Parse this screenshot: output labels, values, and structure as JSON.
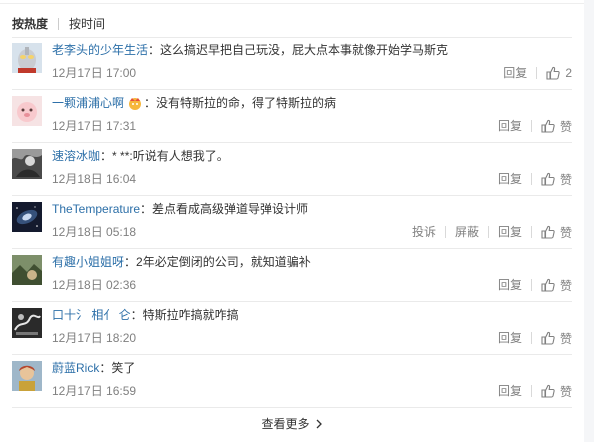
{
  "sort": {
    "hot": "按热度",
    "time": "按时间"
  },
  "comments": [
    {
      "user": "老李头的少年生活",
      "text": "：这么搞迟早把自己玩没，屁大点本事就像开始学马斯克",
      "time": "12月17日 17:00",
      "reply": "回复",
      "like": "2",
      "avatar_icon": "ultraman-avatar"
    },
    {
      "user": "一颗浦浦心啊",
      "text": "：没有特斯拉的命，得了特斯拉的病",
      "time": "12月17日 17:31",
      "reply": "回复",
      "like": "赞",
      "avatar_icon": "pink-cartoon-avatar"
    },
    {
      "user": "速溶冰咖",
      "text": "：* **:听说有人想我了。",
      "time": "12月18日 16:04",
      "reply": "回复",
      "like": "赞",
      "avatar_icon": "gray-portrait-avatar"
    },
    {
      "user": "TheTemperature",
      "text": "：差点看成高级弹道导弹设计师",
      "time": "12月18日 05:18",
      "report": "投诉",
      "block": "屏蔽",
      "reply": "回复",
      "like": "赞",
      "avatar_icon": "galaxy-avatar"
    },
    {
      "user": "有趣小姐姐呀",
      "text": "：2年必定倒闭的公司，就知道骗补",
      "time": "12月18日 02:36",
      "reply": "回复",
      "like": "赞",
      "avatar_icon": "green-landscape-avatar"
    },
    {
      "user": "口十氵 相亻 仑",
      "text": "：特斯拉咋搞就咋搞",
      "time": "12月17日 18:20",
      "reply": "回复",
      "like": "赞",
      "avatar_icon": "dark-bw-avatar"
    },
    {
      "user": "蔚蓝Rick",
      "text": "：笑了",
      "time": "12月17日 16:59",
      "reply": "回复",
      "like": "赞",
      "avatar_icon": "colorful-character-avatar"
    }
  ],
  "more": "查看更多",
  "colors": {
    "username": "#eb7350",
    "username_alt": "#2c6fa8",
    "meta": "#808080",
    "divider": "#eaeaea"
  }
}
